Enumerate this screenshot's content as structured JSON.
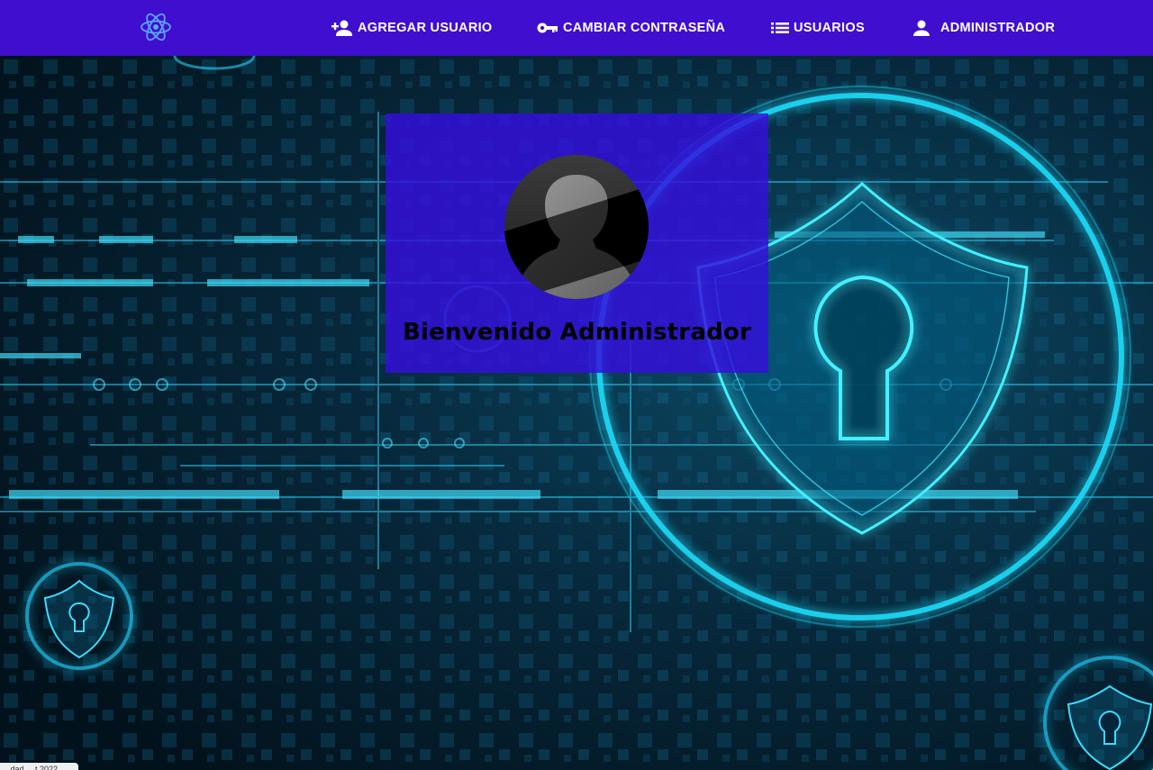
{
  "navbar": {
    "logo_icon": "atom-icon",
    "items": [
      {
        "label": "AGREGAR USUARIO",
        "icon": "person-add-icon"
      },
      {
        "label": "CAMBIAR CONTRASEÑA",
        "icon": "key-icon"
      },
      {
        "label": "USUARIOS",
        "icon": "list-icon"
      },
      {
        "label": "ADMINISTRADOR",
        "icon": "person-icon"
      }
    ]
  },
  "card": {
    "avatar_icon": "user-silhouette-icon",
    "welcome_text": "Bienvenido Administrador"
  },
  "footer": {
    "text": "...dad ... t 2022"
  },
  "colors": {
    "navbar": "#3f0ecf",
    "card": "#340ede",
    "background": "#031722",
    "glow": "#1fd8f5"
  }
}
